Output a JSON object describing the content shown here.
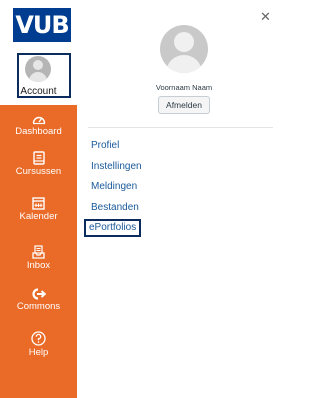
{
  "logo": {
    "text": "VUB"
  },
  "sidebar": {
    "account_label": "Account",
    "items": [
      {
        "label": "Dashboard",
        "icon": "dashboard-icon"
      },
      {
        "label": "Cursussen",
        "icon": "courses-icon"
      },
      {
        "label": "Kalender",
        "icon": "calendar-icon"
      },
      {
        "label": "Inbox",
        "icon": "inbox-icon"
      },
      {
        "label": "Commons",
        "icon": "commons-icon"
      },
      {
        "label": "Help",
        "icon": "help-icon"
      }
    ]
  },
  "tray": {
    "user_name": "Voornaam Naam",
    "logout_label": "Afmelden",
    "links": [
      "Profiel",
      "Instellingen",
      "Meldingen",
      "Bestanden",
      "ePortfolios"
    ]
  },
  "colors": {
    "sidebar": "#ea6b28",
    "logo_blue": "#003c8f",
    "highlight_border": "#0b2c5e",
    "link": "#1a5a9a"
  }
}
